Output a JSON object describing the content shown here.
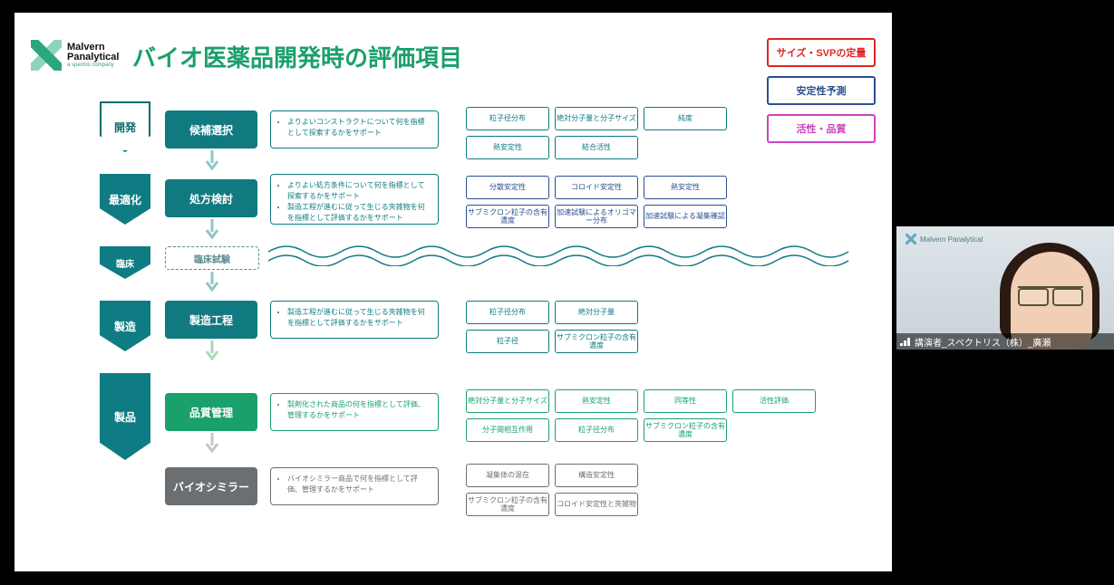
{
  "header": {
    "brand_top": "Malvern",
    "brand_bottom": "Panalytical",
    "brand_tag": "a spectris company",
    "title": "バイオ医薬品開発時の評価項目"
  },
  "legend": [
    {
      "label": "サイズ・SVPの定量",
      "color": "#e02424"
    },
    {
      "label": "安定性予測",
      "color": "#2c4f8f"
    },
    {
      "label": "活性・品質",
      "color": "#d042c3"
    }
  ],
  "stages": {
    "s1": "開発",
    "s2": "最適化",
    "s3": "臨床",
    "s4": "製造",
    "s5": "製品"
  },
  "process": {
    "p1": "候補選択",
    "p2": "処方検討",
    "p3": "臨床試験",
    "p4": "製造工程",
    "p5": "品質管理",
    "p6": "バイオシミラー"
  },
  "desc": {
    "d1_a": "よりよいコンストラクトについて何を指標として探索するかをサポート",
    "d2_a": "よりよい処方条件について何を指標として探索するかをサポート",
    "d2_b": "製造工程が進むに従って生じる夾雑物を何を指標として評価するかをサポート",
    "d4_a": "製造工程が進むに従って生じる夾雑物を何を指標として評価するかをサポート",
    "d5_a": "製剤化された商品の何を指標として評価、管理するかをサポート",
    "d6_a": "バイオシミラー商品で何を指標として評価、管理するかをサポート"
  },
  "tags": {
    "row1": [
      "粒子径分布",
      "絶対分子量と分子サイズ",
      "純度",
      "熱安定性",
      "結合活性"
    ],
    "row2": [
      "分散安定性",
      "コロイド安定性",
      "熱安定性",
      "サブミクロン粒子の含有濃度",
      "加速試験によるオリゴマー分布",
      "加速試験による凝集確認"
    ],
    "row4": [
      "粒子径分布",
      "絶対分子量",
      "粒子径",
      "サブミクロン粒子の含有濃度"
    ],
    "row5": [
      "絶対分子量と分子サイズ",
      "熱安定性",
      "同等性",
      "活性評価",
      "分子間相互作用",
      "粒子径分布",
      "サブミクロン粒子の含有濃度"
    ],
    "row6": [
      "凝集体の混在",
      "構造安定性",
      "サブミクロン粒子の含有濃度",
      "コロイド安定性と夾雑物"
    ]
  },
  "speaker": {
    "brand": "Malvern Panalytical",
    "name": "講演者_スペクトリス（株）_廣瀬"
  }
}
